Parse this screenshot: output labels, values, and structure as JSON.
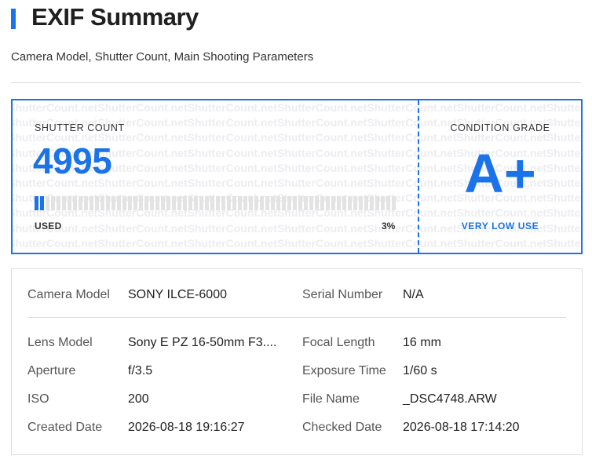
{
  "header": {
    "title": "EXIF Summary",
    "subtitle": "Camera Model, Shutter Count, Main Shooting Parameters"
  },
  "shutter": {
    "label": "SHUTTER COUNT",
    "count": "4995",
    "used_label": "USED",
    "used_percent": "3%",
    "used_fraction": 0.03
  },
  "condition": {
    "label": "CONDITION GRADE",
    "grade": "A+",
    "note": "VERY LOW USE"
  },
  "watermark_text": "ShutterCount.net",
  "details": {
    "camera_model": {
      "label": "Camera Model",
      "value": "SONY ILCE-6000"
    },
    "serial_number": {
      "label": "Serial Number",
      "value": "N/A"
    },
    "lens_model": {
      "label": "Lens Model",
      "value": "Sony E PZ 16-50mm F3...."
    },
    "focal_length": {
      "label": "Focal Length",
      "value": "16 mm"
    },
    "aperture": {
      "label": "Aperture",
      "value": "f/3.5"
    },
    "exposure_time": {
      "label": "Exposure Time",
      "value": "1/60 s"
    },
    "iso": {
      "label": "ISO",
      "value": "200"
    },
    "file_name": {
      "label": "File Name",
      "value": "_DSC4748.ARW"
    },
    "created_date": {
      "label": "Created Date",
      "value": "2026-08-18 19:16:27"
    },
    "checked_date": {
      "label": "Checked Date",
      "value": "2026-08-18 17:14:20"
    }
  },
  "colors": {
    "accent": "#1a73e8",
    "bar_empty": "#e3e3e3",
    "border": "#dcdcdc"
  }
}
